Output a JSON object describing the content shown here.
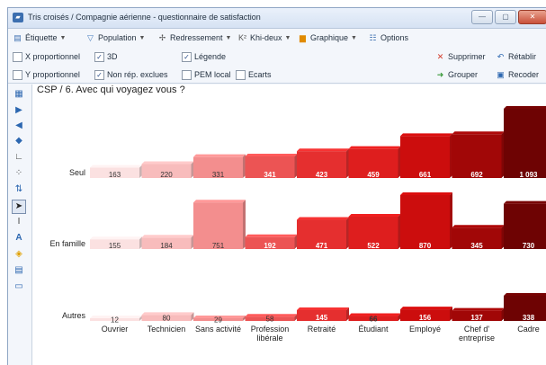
{
  "window": {
    "title": "Tris croisés / Compagnie aérienne - questionnaire de satisfaction",
    "app_icon": "chart-app-icon",
    "controls": [
      "—",
      "▢",
      "✕"
    ]
  },
  "toolbar1": {
    "etiquette": "Étiquette",
    "population": "Population",
    "redressement": "Redressement",
    "khi_deux": "Khi-deux",
    "graphique": "Graphique",
    "options": "Options"
  },
  "toolbar2": {
    "x_proportionnel": "X proportionnel",
    "three_d": "3D",
    "legende": "Légende",
    "supprimer": "Supprimer",
    "retablir": "Rétablir"
  },
  "toolbar3": {
    "y_proportionnel": "Y proportionnel",
    "non_rep_exclues": "Non rép. exclues",
    "pem_local": "PEM local",
    "ecarts": "Ecarts",
    "grouper": "Grouper",
    "recoder": "Recoder"
  },
  "checks": {
    "x_proportionnel": false,
    "three_d": true,
    "legende": true,
    "y_proportionnel": false,
    "non_rep_exclues": true,
    "pem_local": false,
    "ecarts": false
  },
  "colors": {
    "accent": "#3c6fb0",
    "supprimer": "#d23a2a",
    "grouper": "#3a9a3a",
    "recoder": "#2c67b0"
  },
  "chart_data": {
    "type": "bar",
    "title": "CSP / 6. Avec qui voyagez vous ?",
    "categories": [
      "Ouvrier",
      "Technicien",
      "Sans activité",
      "Profession libérale",
      "Retraité",
      "Étudiant",
      "Employé",
      "Chef d' entreprise",
      "Cadre"
    ],
    "rows": [
      "Seul",
      "En famille",
      "Autres"
    ],
    "values": [
      [
        163,
        220,
        331,
        341,
        423,
        459,
        661,
        692,
        1093
      ],
      [
        155,
        184,
        751,
        192,
        471,
        522,
        870,
        345,
        730
      ],
      [
        12,
        80,
        29,
        58,
        145,
        66,
        156,
        137,
        338
      ]
    ],
    "value_labels": [
      [
        "163",
        "220",
        "331",
        "341",
        "423",
        "459",
        "661",
        "692",
        "1 093"
      ],
      [
        "155",
        "184",
        "751",
        "192",
        "471",
        "522",
        "870",
        "345",
        "730"
      ],
      [
        "12",
        "80",
        "29",
        "58",
        "145",
        "66",
        "156",
        "137",
        "338"
      ]
    ],
    "column_colors": [
      "#fbe1e1",
      "#f8bcbc",
      "#f38e8e",
      "#ec5454",
      "#e52f2f",
      "#de1e1e",
      "#cc0d0d",
      "#a10707",
      "#6e0303"
    ],
    "style": "3d",
    "legend": false,
    "grid": false
  }
}
